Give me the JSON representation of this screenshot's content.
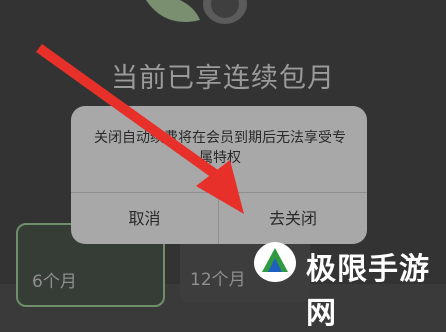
{
  "header": {
    "subscription_status": "当前已享连续包月"
  },
  "plans": [
    {
      "label": "6个月",
      "selected": true
    },
    {
      "label": "12个月",
      "selected": false
    }
  ],
  "dialog": {
    "message": "关闭自动续费将在会员到期后无法享受专属特权",
    "cancel_label": "取消",
    "confirm_label": "去关闭"
  },
  "watermark": {
    "text": "极限手游网"
  },
  "colors": {
    "accent_arrow": "#e8302a",
    "plan_selected_border": "#6f8f6a"
  }
}
